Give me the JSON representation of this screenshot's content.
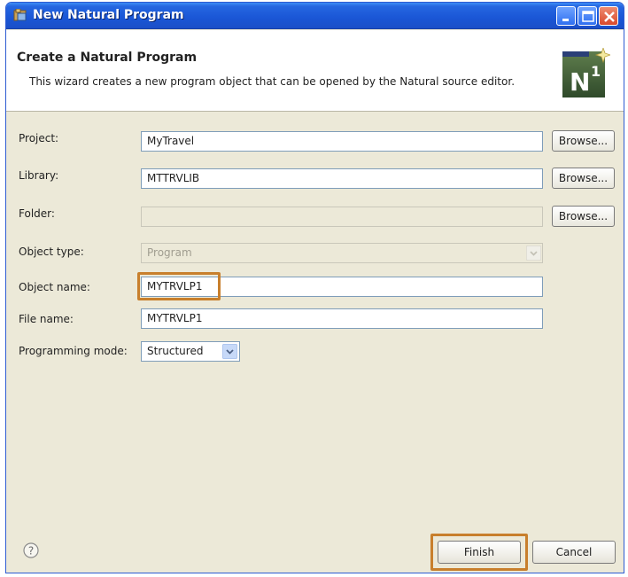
{
  "window": {
    "title": "New Natural Program"
  },
  "header": {
    "title": "Create a Natural Program",
    "description": "This wizard creates a new program object that can be opened by the Natural source editor.",
    "logo_text": "N",
    "logo_superscript": "1"
  },
  "form": {
    "project": {
      "label": "Project:",
      "value": "MyTravel",
      "browse": "Browse..."
    },
    "library": {
      "label": "Library:",
      "value": "MTTRVLIB",
      "browse": "Browse..."
    },
    "folder": {
      "label": "Folder:",
      "value": "",
      "browse": "Browse..."
    },
    "object_type": {
      "label": "Object type:",
      "value": "Program"
    },
    "object_name": {
      "label": "Object name:",
      "value": "MYTRVLP1"
    },
    "file_name": {
      "label": "File name:",
      "value": "MYTRVLP1"
    },
    "programming_mode": {
      "label": "Programming mode:",
      "value": "Structured"
    }
  },
  "footer": {
    "help_symbol": "?",
    "finish": "Finish",
    "cancel": "Cancel"
  },
  "colors": {
    "titlebar": "#1a56d6",
    "highlight": "#c87f2c",
    "dialog_bg": "#ece9d8"
  }
}
